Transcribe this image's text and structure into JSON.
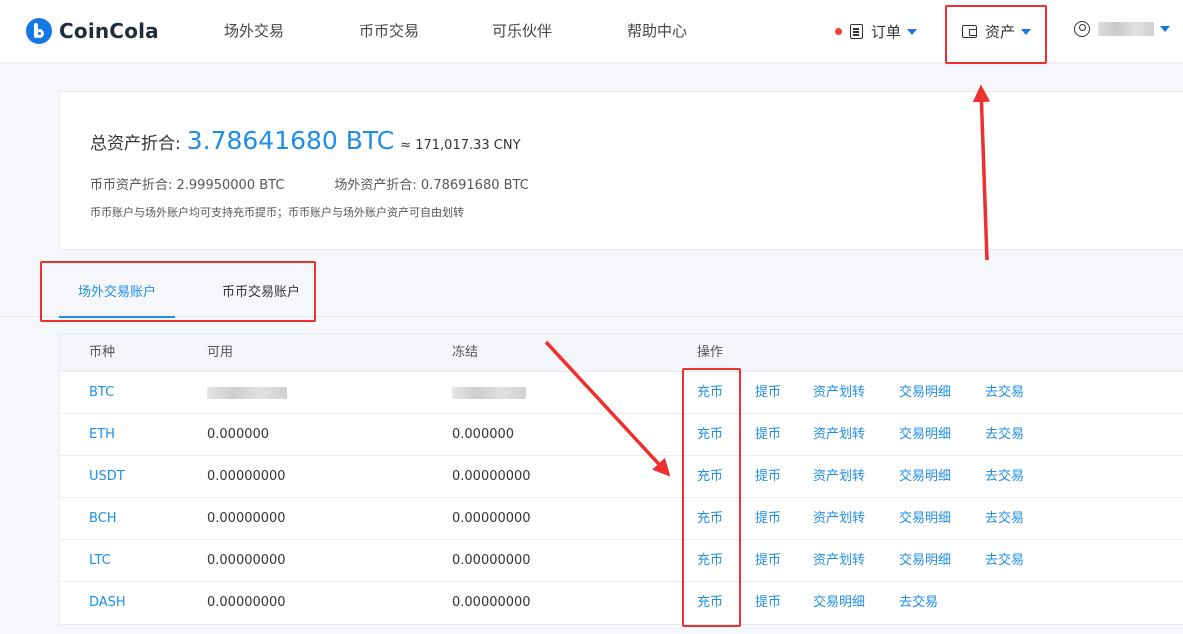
{
  "header": {
    "brand": "CoinCola",
    "nav": [
      "场外交易",
      "币币交易",
      "可乐伙伴",
      "帮助中心"
    ],
    "orders_label": "订单",
    "assets_label": "资产",
    "icons": [
      "logo-icon",
      "document-icon",
      "wallet-icon",
      "user-icon",
      "caret-down-icon"
    ]
  },
  "summary": {
    "total_label": "总资产折合:",
    "total_value": "3.78641680 BTC",
    "approx": "≈ 171,017.33 CNY",
    "spot_label": "币币资产折合: 2.99950000 BTC",
    "otc_label": "场外资产折合: 0.78691680 BTC",
    "note": "币币账户与场外账户均可支持充币提币；币币账户与场外账户资产可自由划转"
  },
  "tabs": [
    {
      "label": "场外交易账户",
      "active": true
    },
    {
      "label": "币币交易账户",
      "active": false
    }
  ],
  "table": {
    "columns": [
      "币种",
      "可用",
      "冻结",
      "操作"
    ],
    "rows": [
      {
        "coin": "BTC",
        "available": "",
        "frozen": "",
        "ops": [
          "充币",
          "提币",
          "资产划转",
          "交易明细",
          "去交易"
        ]
      },
      {
        "coin": "ETH",
        "available": "0.000000",
        "frozen": "0.000000",
        "ops": [
          "充币",
          "提币",
          "资产划转",
          "交易明细",
          "去交易"
        ]
      },
      {
        "coin": "USDT",
        "available": "0.00000000",
        "frozen": "0.00000000",
        "ops": [
          "充币",
          "提币",
          "资产划转",
          "交易明细",
          "去交易"
        ]
      },
      {
        "coin": "BCH",
        "available": "0.00000000",
        "frozen": "0.00000000",
        "ops": [
          "充币",
          "提币",
          "资产划转",
          "交易明细",
          "去交易"
        ]
      },
      {
        "coin": "LTC",
        "available": "0.00000000",
        "frozen": "0.00000000",
        "ops": [
          "充币",
          "提币",
          "资产划转",
          "交易明细",
          "去交易"
        ]
      },
      {
        "coin": "DASH",
        "available": "0.00000000",
        "frozen": "0.00000000",
        "ops": [
          "充币",
          "提币",
          "交易明细",
          "去交易"
        ]
      }
    ]
  },
  "colors": {
    "accent": "#1e8ee8",
    "annotation": "#f0302e",
    "notification_dot": "#f23c3c"
  }
}
